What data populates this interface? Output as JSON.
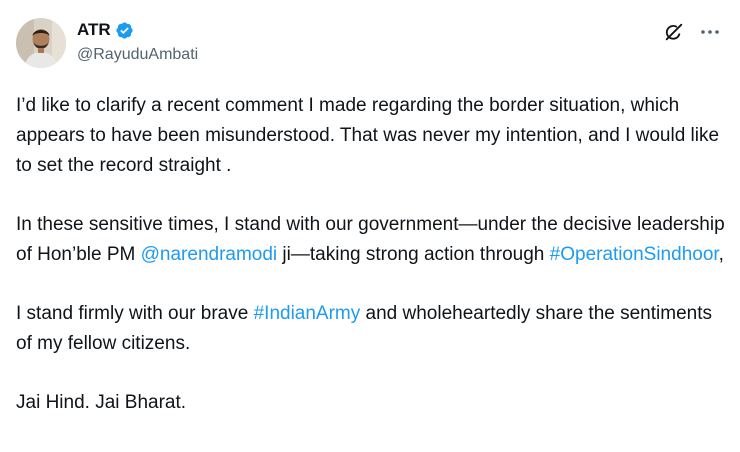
{
  "author": {
    "display_name": "ATR",
    "handle": "@RayuduAmbati",
    "verified": true,
    "avatar_icon": "profile-photo"
  },
  "actions": {
    "grok_icon": "grok-icon",
    "more_icon": "more-horizontal-icon"
  },
  "colors": {
    "link": "#1d9bf0",
    "verified_badge": "#1d9bf0",
    "text": "#0f1419",
    "secondary_text": "#536471"
  },
  "tweet": {
    "p1": "I’d like to clarify a recent comment I made regarding the border situation, which appears to have been misunderstood. That was never my intention, and I would like to set the record straight .",
    "p2_a": "In these sensitive times, I stand with our government—under the decisive leadership of Hon’ble PM ",
    "p2_mention": "@narendramodi",
    "p2_b": " ji—taking strong action through ",
    "p2_hashtag": "#OperationSindhoor",
    "p2_c": ",",
    "p3_a": "I stand firmly with our brave ",
    "p3_hashtag": "#IndianArmy",
    "p3_b": " and wholeheartedly share the sentiments of my fellow citizens.",
    "p4": "Jai Hind. Jai Bharat."
  }
}
